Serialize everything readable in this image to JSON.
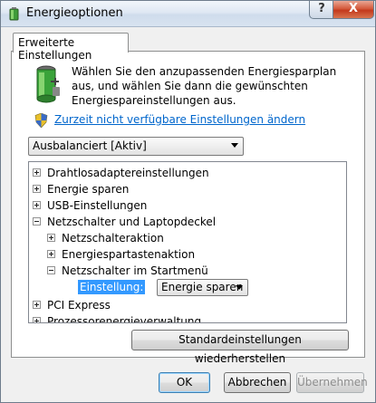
{
  "window": {
    "title": "Energieoptionen",
    "help_glyph": "?",
    "close_glyph": "X"
  },
  "tab": {
    "label": "Erweiterte Einstellungen"
  },
  "intro_text": "Wählen Sie den anzupassenden Energiesparplan aus, und wählen Sie dann die gewünschten Energiespareinstellungen aus.",
  "change_link": "Zurzeit nicht verfügbare Einstellungen ändern",
  "plan_select": {
    "value": "Ausbalanciert [Aktiv]"
  },
  "tree": {
    "items": [
      {
        "label": "Drahtlosadaptereinstellungen",
        "state": "collapsed"
      },
      {
        "label": "Energie sparen",
        "state": "collapsed"
      },
      {
        "label": "USB-Einstellungen",
        "state": "collapsed"
      },
      {
        "label": "Netzschalter und Laptopdeckel",
        "state": "expanded"
      },
      {
        "label": "Netzschalteraktion",
        "state": "collapsed"
      },
      {
        "label": "Energiespartastenaktion",
        "state": "collapsed"
      },
      {
        "label": "Netzschalter im Startmenü",
        "state": "expanded"
      },
      {
        "label": "PCI Express",
        "state": "collapsed"
      },
      {
        "label": "Prozessorenergieverwaltung",
        "state": "collapsed"
      }
    ],
    "setting": {
      "label": "Einstellung:",
      "value": "Energie sparen"
    }
  },
  "buttons": {
    "restore": "Standardeinstellungen wiederherstellen",
    "ok": "OK",
    "cancel": "Abbrechen",
    "apply": "Übernehmen"
  },
  "colors": {
    "selection": "#3399ff",
    "link": "#0066cc",
    "close_red": "#c3391c"
  }
}
